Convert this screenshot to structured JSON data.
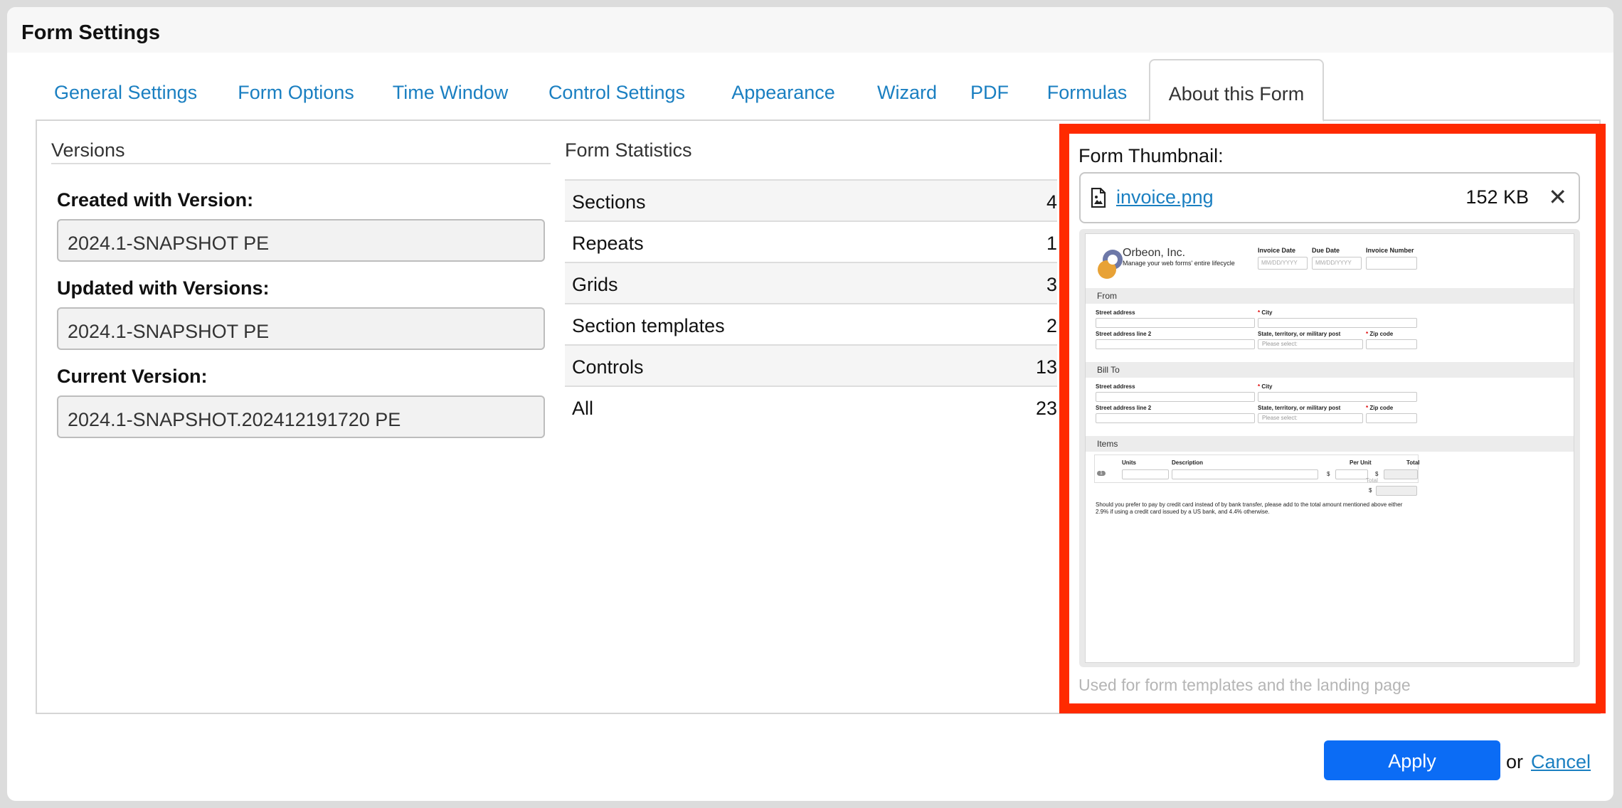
{
  "dialog": {
    "title": "Form Settings"
  },
  "tabs": [
    {
      "label": "General Settings"
    },
    {
      "label": "Form Options"
    },
    {
      "label": "Time Window"
    },
    {
      "label": "Control Settings"
    },
    {
      "label": "Appearance"
    },
    {
      "label": "Wizard"
    },
    {
      "label": "PDF"
    },
    {
      "label": "Formulas"
    },
    {
      "label": "About this Form",
      "active": true
    }
  ],
  "versions": {
    "heading": "Versions",
    "created_label": "Created with Version:",
    "created_value": "2024.1-SNAPSHOT PE",
    "updated_label": "Updated with Versions:",
    "updated_value": "2024.1-SNAPSHOT PE",
    "current_label": "Current Version:",
    "current_value": "2024.1-SNAPSHOT.202412191720 PE"
  },
  "statistics": {
    "heading": "Form Statistics",
    "rows": [
      {
        "label": "Sections",
        "value": "4"
      },
      {
        "label": "Repeats",
        "value": "1"
      },
      {
        "label": "Grids",
        "value": "3"
      },
      {
        "label": "Section templates",
        "value": "2"
      },
      {
        "label": "Controls",
        "value": "13"
      },
      {
        "label": "All",
        "value": "23"
      }
    ]
  },
  "thumbnail": {
    "label": "Form Thumbnail:",
    "file_name": "invoice.png",
    "file_size": "152 KB",
    "close_glyph": "✕",
    "hint": "Used for form templates and the landing page",
    "preview": {
      "company": "Orbeon, Inc.",
      "tagline": "Manage your web forms' entire lifecycle",
      "invoice_date": "Invoice Date",
      "due_date": "Due Date",
      "invoice_number": "Invoice Number",
      "date_placeholder": "MM/DD/YYYY",
      "from_section": "From",
      "bill_to_section": "Bill To",
      "items_section": "Items",
      "street_address": "Street address",
      "street_address_2": "Street address line 2",
      "city": "City",
      "state": "State, territory, or military post",
      "zip": "Zip code",
      "please_select": "Please select:",
      "col_units": "Units",
      "col_description": "Description",
      "col_per_unit": "Per Unit",
      "col_total": "Total",
      "total_label": "Total",
      "currency": "$",
      "row_number": "1",
      "footnote": "Should you prefer to pay by credit card instead of by bank transfer, please add to the total amount mentioned above either 2.9% if using a credit card issued by a US bank, and 4.4% otherwise."
    }
  },
  "footer": {
    "apply_label": "Apply",
    "or_text": "or",
    "cancel_label": "Cancel"
  },
  "colors": {
    "accent": "#1a7fc1",
    "apply_button": "#0b6cf5",
    "highlight_border": "#ff2a00"
  }
}
